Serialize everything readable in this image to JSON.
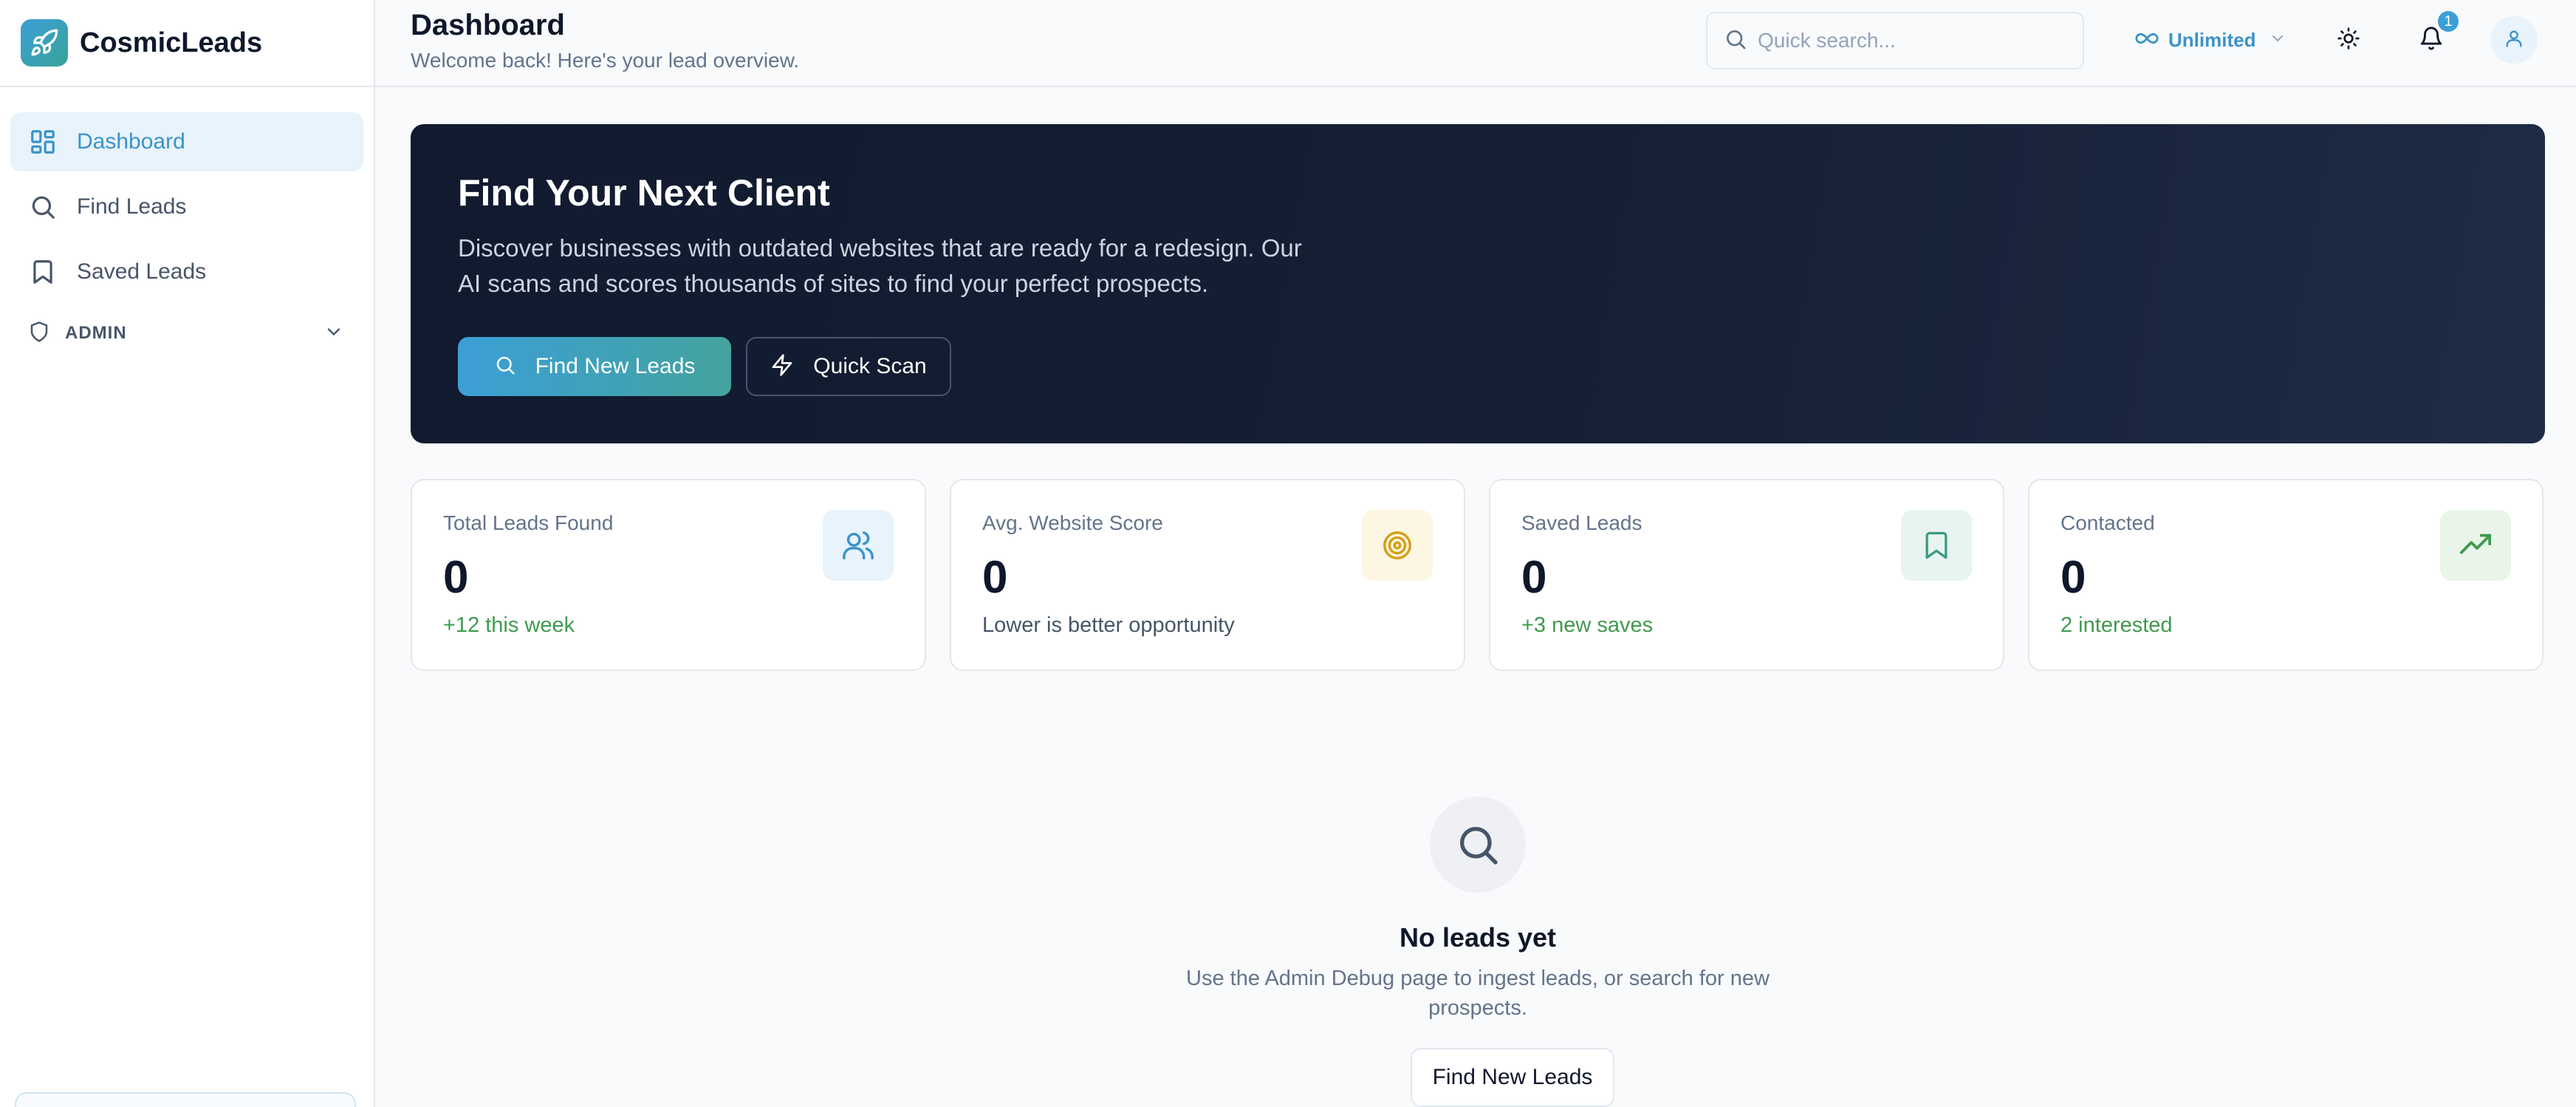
{
  "app": {
    "name": "CosmicLeads"
  },
  "sidebar": {
    "items": [
      {
        "label": "Dashboard",
        "icon": "dashboard-grid-icon",
        "active": true
      },
      {
        "label": "Find Leads",
        "icon": "search-icon",
        "active": false
      },
      {
        "label": "Saved Leads",
        "icon": "bookmark-icon",
        "active": false
      }
    ],
    "section": {
      "label": "ADMIN",
      "icon": "shield-icon"
    }
  },
  "header": {
    "title": "Dashboard",
    "subtitle": "Welcome back! Here's your lead overview.",
    "search_placeholder": "Quick search...",
    "plan_label": "Unlimited",
    "notification_count": "1"
  },
  "hero": {
    "title": "Find Your Next Client",
    "text": "Discover businesses with outdated websites that are ready for a redesign. Our AI scans and scores thousands of sites to find your perfect prospects.",
    "primary_label": "Find New Leads",
    "secondary_label": "Quick Scan"
  },
  "stats": [
    {
      "label": "Total Leads Found",
      "value": "0",
      "sub": "+12 this week",
      "icon": "users-icon"
    },
    {
      "label": "Avg. Website Score",
      "value": "0",
      "sub": "Lower is better opportunity",
      "icon": "target-icon"
    },
    {
      "label": "Saved Leads",
      "value": "0",
      "sub": "+3 new saves",
      "icon": "bookmark-icon"
    },
    {
      "label": "Contacted",
      "value": "0",
      "sub": "2 interested",
      "icon": "trending-up-icon"
    }
  ],
  "empty": {
    "title": "No leads yet",
    "text": "Use the Admin Debug page to ingest leads, or search for new prospects.",
    "button_label": "Find New Leads"
  },
  "colors": {
    "accent": "#3b93c9",
    "hero_bg": "#111a2e",
    "positive": "#3f9a4f"
  }
}
